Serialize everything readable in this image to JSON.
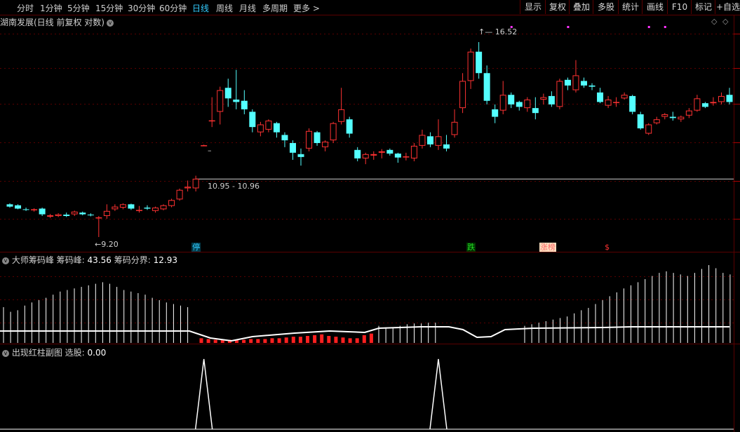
{
  "toolbar": {
    "periods": [
      "分时",
      "1分钟",
      "5分钟",
      "15分钟",
      "30分钟",
      "60分钟",
      "日线",
      "周线",
      "月线",
      "多周期",
      "更多 >"
    ],
    "active_period": "日线",
    "buttons": [
      "显示",
      "复权",
      "叠加",
      "多股",
      "统计",
      "画线",
      "F10",
      "标记",
      "+自选"
    ]
  },
  "main_chart": {
    "stock_title": "湖南发展(日线 前复权 对数)",
    "high_label": "16.52",
    "low_label": "9.20",
    "price_label": "10.95 - 10.96",
    "price_line_value": 10.95,
    "dash_marker_label": "–",
    "annotations": [
      {
        "text": "停",
        "index": 23,
        "color": "#33ccff",
        "bg": "#003a4a"
      },
      {
        "text": "跌",
        "index": 57,
        "color": "#22dd22",
        "bg": "#003300"
      },
      {
        "text": "涨榜",
        "index": 66,
        "color": "#ff6666",
        "bg": "#ffe0c0"
      },
      {
        "text": "$",
        "index": 74,
        "color": "#ff3333",
        "bg": "transparent"
      }
    ],
    "magenta_markers": [
      62,
      69,
      79,
      81
    ]
  },
  "indicator1": {
    "title_name": "大师筹码峰",
    "field1_label": "筹码峰:",
    "field1_value": "43.56",
    "field2_label": "筹码分界:",
    "field2_value": "12.93"
  },
  "indicator2": {
    "title_name": "出现红柱副图",
    "field1_label": "选股:",
    "field1_value": "0.00",
    "spikes": [
      24,
      53
    ]
  },
  "candles": [
    [
      10.15,
      10.08,
      10.18,
      10.05
    ],
    [
      10.12,
      10.02,
      10.15,
      10.0
    ],
    [
      10.0,
      9.98,
      10.05,
      9.95
    ],
    [
      9.98,
      10.0,
      10.03,
      9.93
    ],
    [
      10.02,
      9.85,
      10.05,
      9.8
    ],
    [
      9.78,
      9.82,
      9.86,
      9.74
    ],
    [
      9.8,
      9.85,
      9.88,
      9.77
    ],
    [
      9.84,
      9.8,
      9.9,
      9.77
    ],
    [
      9.85,
      9.93,
      9.96,
      9.8
    ],
    [
      9.9,
      9.85,
      9.93,
      9.82
    ],
    [
      9.84,
      9.82,
      9.88,
      9.79
    ],
    [
      9.75,
      9.76,
      9.8,
      9.2
    ],
    [
      9.8,
      9.95,
      10.15,
      9.72
    ],
    [
      10.0,
      10.08,
      10.15,
      9.95
    ],
    [
      10.05,
      10.15,
      10.18,
      10.0
    ],
    [
      10.15,
      10.02,
      10.17,
      9.98
    ],
    [
      9.95,
      9.98,
      10.1,
      9.9
    ],
    [
      10.05,
      10.02,
      10.12,
      9.98
    ],
    [
      9.95,
      10.05,
      10.08,
      9.9
    ],
    [
      10.0,
      10.12,
      10.15,
      9.97
    ],
    [
      10.1,
      10.28,
      10.32,
      10.06
    ],
    [
      10.3,
      10.6,
      10.64,
      10.26
    ],
    [
      10.65,
      10.7,
      10.9,
      10.55
    ],
    [
      10.65,
      10.96,
      11.06,
      10.55
    ],
    [
      12.1,
      12.12,
      12.14,
      12.1
    ],
    [
      13.05,
      13.06,
      14.0,
      12.8
    ],
    [
      13.4,
      14.3,
      14.45,
      12.9
    ],
    [
      14.4,
      13.95,
      14.8,
      13.6
    ],
    [
      13.9,
      13.8,
      15.2,
      13.5
    ],
    [
      13.85,
      13.5,
      14.3,
      13.3
    ],
    [
      13.4,
      12.8,
      13.5,
      12.6
    ],
    [
      12.6,
      12.9,
      13.0,
      12.45
    ],
    [
      12.7,
      13.05,
      13.1,
      12.6
    ],
    [
      12.95,
      12.6,
      13.0,
      12.4
    ],
    [
      12.5,
      12.3,
      12.6,
      12.05
    ],
    [
      12.2,
      11.85,
      12.3,
      11.6
    ],
    [
      11.8,
      11.7,
      12.0,
      11.4
    ],
    [
      12.0,
      12.65,
      12.75,
      11.9
    ],
    [
      12.6,
      12.2,
      12.65,
      12.1
    ],
    [
      12.05,
      12.25,
      12.3,
      11.9
    ],
    [
      12.3,
      12.95,
      13.0,
      12.2
    ],
    [
      13.0,
      13.5,
      14.4,
      12.9
    ],
    [
      13.1,
      12.55,
      13.2,
      12.4
    ],
    [
      11.95,
      11.65,
      12.05,
      11.55
    ],
    [
      11.65,
      11.8,
      11.85,
      11.45
    ],
    [
      11.75,
      11.8,
      11.9,
      11.6
    ],
    [
      11.85,
      11.9,
      11.98,
      11.65
    ],
    [
      11.95,
      11.82,
      12.0,
      11.75
    ],
    [
      11.82,
      11.68,
      11.85,
      11.5
    ],
    [
      11.72,
      11.72,
      11.85,
      11.58
    ],
    [
      11.65,
      12.1,
      12.2,
      11.55
    ],
    [
      12.1,
      12.5,
      12.7,
      12.0
    ],
    [
      12.45,
      12.15,
      12.6,
      12.05
    ],
    [
      12.1,
      12.45,
      13.1,
      11.95
    ],
    [
      12.15,
      12.0,
      12.5,
      11.9
    ],
    [
      12.5,
      13.0,
      13.5,
      12.4
    ],
    [
      13.55,
      14.7,
      15.05,
      13.35
    ],
    [
      14.7,
      16.05,
      16.2,
      14.35
    ],
    [
      16.05,
      15.05,
      16.52,
      14.8
    ],
    [
      15.05,
      13.85,
      15.4,
      13.7
    ],
    [
      13.5,
      13.2,
      13.7,
      12.95
    ],
    [
      13.45,
      14.1,
      14.7,
      13.3
    ],
    [
      14.1,
      13.7,
      14.2,
      13.55
    ],
    [
      13.8,
      13.6,
      13.85,
      13.45
    ],
    [
      13.55,
      13.9,
      14.0,
      13.4
    ],
    [
      13.55,
      13.35,
      14.0,
      13.1
    ],
    [
      13.9,
      14.0,
      14.15,
      13.7
    ],
    [
      14.05,
      13.7,
      14.25,
      13.6
    ],
    [
      13.6,
      14.7,
      14.8,
      13.5
    ],
    [
      14.75,
      14.5,
      14.85,
      14.3
    ],
    [
      14.3,
      14.95,
      15.65,
      14.2
    ],
    [
      14.7,
      14.5,
      14.85,
      14.4
    ],
    [
      14.5,
      14.45,
      14.6,
      14.3
    ],
    [
      14.2,
      13.8,
      14.4,
      13.75
    ],
    [
      13.65,
      13.9,
      14.05,
      13.55
    ],
    [
      13.8,
      13.8,
      14.0,
      13.6
    ],
    [
      13.95,
      14.1,
      14.2,
      13.9
    ],
    [
      14.05,
      13.4,
      14.1,
      13.3
    ],
    [
      13.3,
      12.75,
      13.4,
      12.7
    ],
    [
      12.55,
      12.9,
      12.95,
      12.5
    ],
    [
      12.95,
      13.1,
      13.2,
      12.9
    ],
    [
      13.2,
      13.3,
      13.35,
      13.1
    ],
    [
      13.2,
      13.15,
      13.4,
      13.05
    ],
    [
      13.1,
      13.2,
      13.25,
      13.0
    ],
    [
      13.25,
      13.45,
      13.55,
      13.15
    ],
    [
      13.45,
      13.95,
      14.1,
      13.4
    ],
    [
      13.75,
      13.6,
      13.8,
      13.55
    ],
    [
      13.75,
      13.8,
      14.0,
      13.65
    ],
    [
      13.8,
      14.05,
      14.2,
      13.7
    ],
    [
      14.1,
      13.8,
      14.4,
      13.7
    ]
  ],
  "bars1": {
    "white": [
      0.46,
      0.4,
      0.42,
      0.48,
      0.52,
      0.55,
      0.58,
      0.62,
      0.66,
      0.68,
      0.7,
      0.72,
      0.74,
      0.76,
      0.78,
      0.76,
      0.72,
      0.68,
      0.66,
      0.64,
      0.62,
      0.58,
      0.55,
      0.52,
      0.5,
      0.48,
      0.46
    ],
    "white_right": [
      0.22,
      0.24,
      0.26,
      0.28,
      0.3,
      0.32,
      0.34,
      0.38,
      0.42,
      0.45,
      0.5,
      0.55,
      0.6,
      0.65,
      0.7,
      0.74,
      0.78,
      0.82,
      0.86,
      0.9,
      0.92,
      0.9,
      0.88,
      0.86,
      0.9,
      0.95,
      1.0,
      0.96,
      0.9,
      0.88
    ],
    "red": [
      0.06,
      0.05,
      0.04,
      0.04,
      0.04,
      0.04,
      0.04,
      0.05,
      0.05,
      0.05,
      0.06,
      0.06,
      0.07,
      0.08,
      0.08,
      0.09,
      0.1,
      0.11,
      0.09,
      0.08,
      0.07,
      0.06,
      0.06,
      0.1,
      0.12,
      0.14,
      0.16,
      0.16,
      0.16,
      0.16,
      0.14,
      0.12,
      0.1,
      0.12,
      0.14
    ],
    "mid_white": [
      0.22,
      0.2,
      0.2,
      0.22,
      0.24,
      0.25,
      0.25,
      0.26,
      0.26
    ]
  }
}
